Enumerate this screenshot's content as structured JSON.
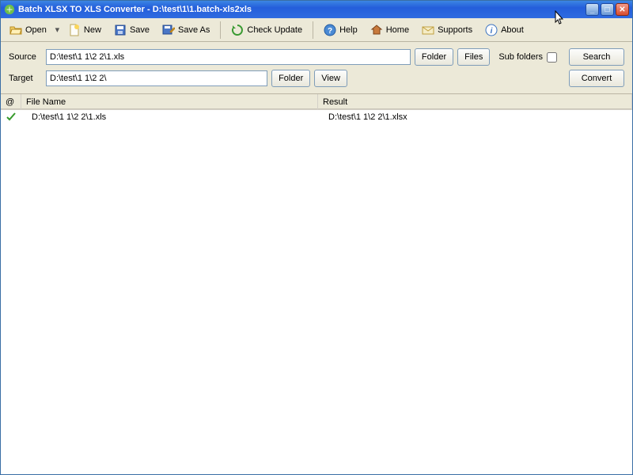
{
  "title": "Batch XLSX TO XLS Converter - D:\\test\\1\\1.batch-xls2xls",
  "toolbar": {
    "open": "Open",
    "new": "New",
    "save": "Save",
    "saveas": "Save As",
    "check": "Check Update",
    "help": "Help",
    "home": "Home",
    "supports": "Supports",
    "about": "About"
  },
  "form": {
    "source_label": "Source",
    "source_value": "D:\\test\\1 1\\2 2\\1.xls",
    "target_label": "Target",
    "target_value": "D:\\test\\1 1\\2 2\\",
    "folder": "Folder",
    "files": "Files",
    "view": "View",
    "subfolders": "Sub folders",
    "search": "Search",
    "convert": "Convert"
  },
  "columns": {
    "status": "@",
    "file": "File Name",
    "result": "Result"
  },
  "rows": [
    {
      "file": "D:\\test\\1 1\\2 2\\1.xls",
      "result": "D:\\test\\1 1\\2 2\\1.xlsx"
    }
  ]
}
